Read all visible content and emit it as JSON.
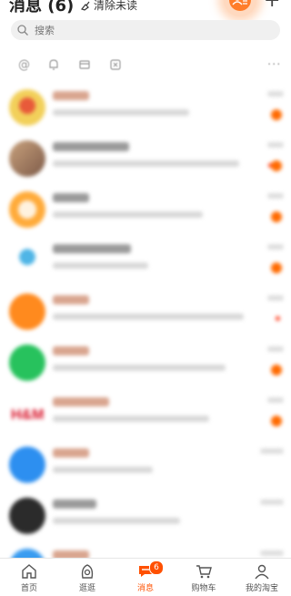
{
  "header": {
    "title": "消息 (6)",
    "clear_label": "清除未读"
  },
  "search": {
    "placeholder": "搜索"
  },
  "tabbar": {
    "items": [
      {
        "label": "首页"
      },
      {
        "label": "逛逛"
      },
      {
        "label": "消息",
        "badge": "6"
      },
      {
        "label": "购物车"
      },
      {
        "label": "我的淘宝"
      }
    ]
  },
  "colors": {
    "accent": "#ff5000",
    "compose_bg": "#ff7d2a",
    "unread_dot": "#ff6a00"
  }
}
